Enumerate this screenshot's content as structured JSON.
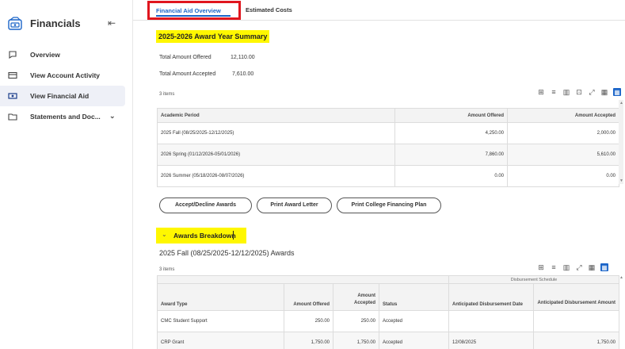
{
  "sidebar": {
    "title": "Financials",
    "collapse_icon": "collapse-left-icon",
    "items": [
      {
        "label": "Overview",
        "icon": "chat-bubble-icon"
      },
      {
        "label": "View Account Activity",
        "icon": "card-icon"
      },
      {
        "label": "View Financial Aid",
        "icon": "money-icon"
      },
      {
        "label": "Statements and Doc...",
        "icon": "folder-icon"
      }
    ]
  },
  "tabs": [
    "Financial Aid Overview",
    "Estimated Costs"
  ],
  "summary": {
    "title": "2025-2026 Award Year Summary",
    "offered_label": "Total Amount Offered",
    "offered_value": "12,110.00",
    "accepted_label": "Total Amount Accepted",
    "accepted_value": "7,610.00"
  },
  "table1": {
    "count": "3 items",
    "headers": [
      "Academic Period",
      "Amount Offered",
      "Amount Accepted"
    ],
    "rows": [
      [
        "2025 Fall (08/25/2025-12/12/2025)",
        "4,250.00",
        "2,000.00"
      ],
      [
        "2026 Spring (01/12/2026-05/01/2026)",
        "7,860.00",
        "5,610.00"
      ],
      [
        "2026 Summer (05/18/2026-08/07/2026)",
        "0.00",
        "0.00"
      ]
    ]
  },
  "buttons": [
    "Accept/Decline Awards",
    "Print Award Letter",
    "Print College Financing Plan"
  ],
  "breakdown": {
    "title": "Awards Breakdown",
    "period_title": "2025 Fall (08/25/2025-12/12/2025) Awards"
  },
  "table2": {
    "count": "3 items",
    "group_header": "Disbursement Schedule",
    "headers": [
      "Award Type",
      "Amount Offered",
      "Amount Accepted",
      "Status",
      "Anticipated Disbursement Date",
      "Anticipated Disbursement Amount"
    ],
    "rows": [
      [
        "CMC Student Support",
        "250.00",
        "250.00",
        "Accepted",
        "",
        ""
      ],
      [
        "CRP Grant",
        "1,750.00",
        "1,750.00",
        "Accepted",
        "12/08/2025",
        "1,750.00"
      ]
    ]
  },
  "colors": {
    "accent": "#1a64c8",
    "highlight": "#fff700",
    "tab_outline": "#e0161e"
  }
}
